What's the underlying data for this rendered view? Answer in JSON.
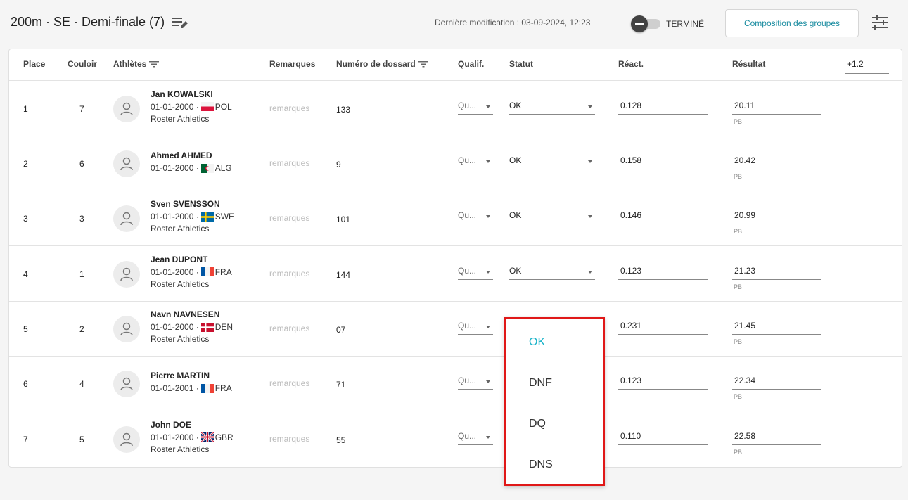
{
  "header": {
    "title": "200m · SE · Demi-finale (7)",
    "last_modified": "Dernière modification : 03-09-2024, 12:23",
    "toggle_label": "TERMINÉ",
    "groups_button": "Composition des groupes"
  },
  "table": {
    "columns": {
      "place": "Place",
      "lane": "Couloir",
      "athletes": "Athlètes",
      "remarks": "Remarques",
      "bib": "Numéro de dossard",
      "qual": "Qualif.",
      "status": "Statut",
      "reaction": "Réact.",
      "result": "Résultat"
    },
    "wind": "+1.2",
    "rows": [
      {
        "place": "1",
        "lane": "7",
        "name": "Jan KOWALSKI",
        "dob": "01-01-2000 ·",
        "country": "POL",
        "club": "Roster Athletics",
        "remarks": "remarques",
        "bib": "133",
        "qual": "Qu...",
        "status": "OK",
        "reaction": "0.128",
        "result": "20.11",
        "note": "PB"
      },
      {
        "place": "2",
        "lane": "6",
        "name": "Ahmed AHMED",
        "dob": "01-01-2000 ·",
        "country": "ALG",
        "club": "",
        "remarks": "remarques",
        "bib": "9",
        "qual": "Qu...",
        "status": "OK",
        "reaction": "0.158",
        "result": "20.42",
        "note": "PB"
      },
      {
        "place": "3",
        "lane": "3",
        "name": "Sven SVENSSON",
        "dob": "01-01-2000 ·",
        "country": "SWE",
        "club": "Roster Athletics",
        "remarks": "remarques",
        "bib": "101",
        "qual": "Qu...",
        "status": "OK",
        "reaction": "0.146",
        "result": "20.99",
        "note": "PB"
      },
      {
        "place": "4",
        "lane": "1",
        "name": "Jean DUPONT",
        "dob": "01-01-2000 ·",
        "country": "FRA",
        "club": "Roster Athletics",
        "remarks": "remarques",
        "bib": "144",
        "qual": "Qu...",
        "status": "OK",
        "reaction": "0.123",
        "result": "21.23",
        "note": "PB"
      },
      {
        "place": "5",
        "lane": "2",
        "name": "Navn NAVNESEN",
        "dob": "01-01-2000 ·",
        "country": "DEN",
        "club": "Roster Athletics",
        "remarks": "remarques",
        "bib": "07",
        "qual": "Qu...",
        "status": "",
        "reaction": "0.231",
        "result": "21.45",
        "note": "PB"
      },
      {
        "place": "6",
        "lane": "4",
        "name": "Pierre MARTIN",
        "dob": "01-01-2001 ·",
        "country": "FRA",
        "club": "",
        "remarks": "remarques",
        "bib": "71",
        "qual": "Qu...",
        "status": "",
        "reaction": "0.123",
        "result": "22.34",
        "note": "PB"
      },
      {
        "place": "7",
        "lane": "5",
        "name": "John DOE",
        "dob": "01-01-2000 ·",
        "country": "GBR",
        "club": "Roster Athletics",
        "remarks": "remarques",
        "bib": "55",
        "qual": "Qu...",
        "status": "",
        "reaction": "0.110",
        "result": "22.58",
        "note": "PB"
      }
    ]
  },
  "status_menu": {
    "options": [
      "OK",
      "DNF",
      "DQ",
      "DNS"
    ],
    "selected": "OK"
  },
  "colors": {
    "accent": "#1a8ca0",
    "menu_selected": "#1ab3c9",
    "highlight_border": "#e01818"
  },
  "icons": {
    "edit": "playlist-edit-icon",
    "tune": "tune-icon",
    "filter": "filter-icon",
    "avatar": "person-icon"
  }
}
